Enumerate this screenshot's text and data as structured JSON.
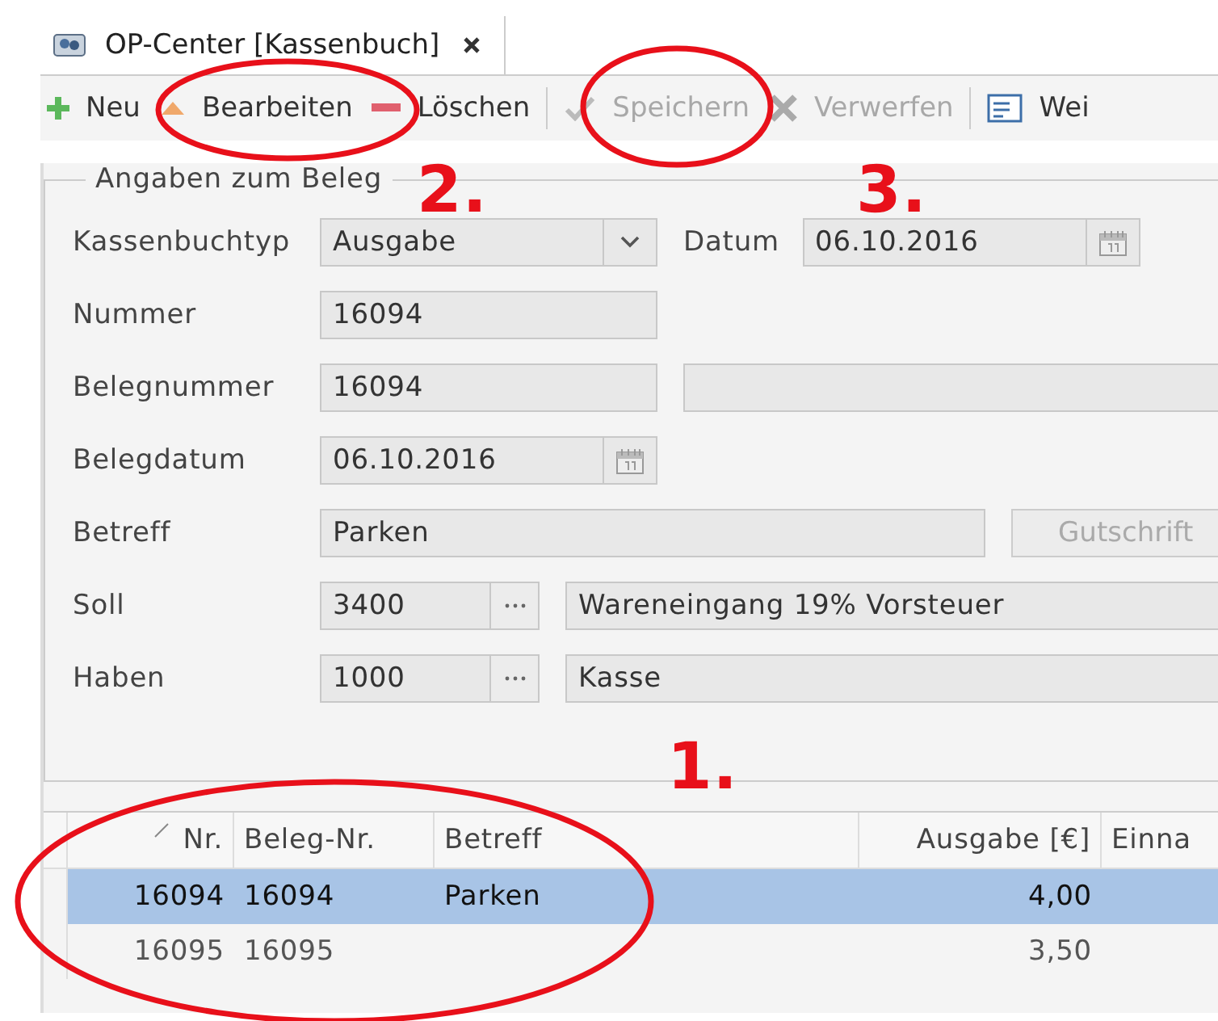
{
  "tab": {
    "title": "OP-Center [Kassenbuch]",
    "selected": true
  },
  "toolbar": [
    {
      "kind": "add",
      "label": "Neu",
      "disabled": false
    },
    {
      "kind": "edit",
      "label": "Bearbeiten",
      "disabled": false
    },
    {
      "kind": "delete",
      "label": "Löschen",
      "disabled": false
    },
    {
      "kind": "separator"
    },
    {
      "kind": "save",
      "label": "Speichern",
      "disabled": true
    },
    {
      "kind": "discard",
      "label": "Verwerfen",
      "disabled": true
    },
    {
      "kind": "separator"
    },
    {
      "kind": "form",
      "label": "Wei",
      "disabled": false
    }
  ],
  "form": {
    "legend": "Angaben zum Beleg",
    "rows": [
      {
        "label": "Kassenbuchtyp",
        "fields": [
          {
            "kind": "combo",
            "value": "Ausgabe"
          },
          {
            "kind": "label",
            "text": "Datum"
          },
          {
            "kind": "date",
            "value": "06.10.2016"
          }
        ]
      },
      {
        "label": "Nummer",
        "fields": [
          {
            "kind": "text",
            "value": "16094"
          }
        ]
      },
      {
        "label": "Belegnummer",
        "fields": [
          {
            "kind": "text",
            "value": "16094"
          },
          {
            "kind": "text"
          }
        ]
      },
      {
        "label": "Belegdatum",
        "fields": [
          {
            "kind": "date",
            "value": "06.10.2016"
          }
        ]
      },
      {
        "label": "Betreff",
        "fields": [
          {
            "kind": "text",
            "value": "Parken"
          },
          {
            "kind": "button",
            "text": "Gutschrift",
            "disabled": true
          }
        ]
      },
      {
        "label": "Soll",
        "fields": [
          {
            "kind": "lookup",
            "code": "3400",
            "text": "Wareneingang 19% Vorsteuer"
          }
        ]
      },
      {
        "label": "Haben",
        "fields": [
          {
            "kind": "lookup",
            "code": "1000",
            "text": "Kasse"
          }
        ]
      }
    ]
  },
  "grid": {
    "columns": [
      {
        "label": "Nr.",
        "sorted": true
      },
      {
        "label": "Beleg-Nr.",
        "sorted": false
      },
      {
        "label": "Betreff",
        "sorted": false
      },
      {
        "label": "Ausgabe [€]",
        "sorted": false
      },
      {
        "label": "Einna",
        "sorted": false
      }
    ],
    "rows": [
      {
        "nr": "16094",
        "beleg_nr": "16094",
        "betreff": "Parken",
        "ausgabe": "4,00",
        "selected": true
      },
      {
        "nr": "16095",
        "beleg_nr": "16095",
        "ausgabe": "3,50",
        "selected": false
      }
    ]
  },
  "annotations": [
    {
      "label": "2."
    },
    {
      "label": "3."
    },
    {
      "label": "1."
    }
  ]
}
